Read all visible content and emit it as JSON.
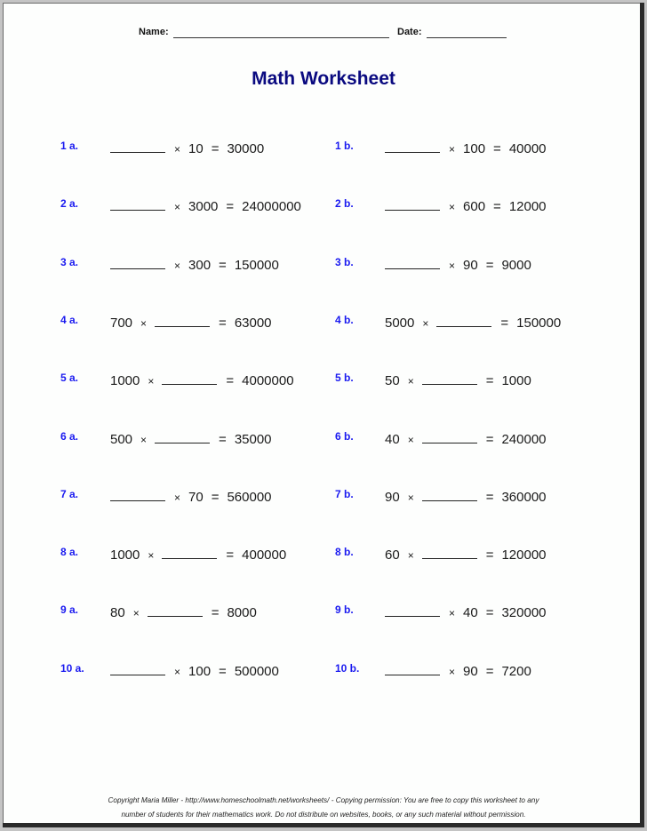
{
  "header": {
    "name_label": "Name:",
    "date_label": "Date:"
  },
  "title": "Math Worksheet",
  "colors": {
    "title": "#0a0a80",
    "problem_number": "#1a1af0"
  },
  "problems": [
    {
      "label": "1 a.",
      "tokens": [
        "_",
        "×",
        "10",
        "=",
        "30000"
      ]
    },
    {
      "label": "1 b.",
      "tokens": [
        "_",
        "×",
        "100",
        "=",
        "40000"
      ]
    },
    {
      "label": "2 a.",
      "tokens": [
        "_",
        "×",
        "3000",
        "=",
        "24000000"
      ]
    },
    {
      "label": "2 b.",
      "tokens": [
        "_",
        "×",
        "600",
        "=",
        "12000"
      ]
    },
    {
      "label": "3 a.",
      "tokens": [
        "_",
        "×",
        "300",
        "=",
        "150000"
      ]
    },
    {
      "label": "3 b.",
      "tokens": [
        "_",
        "×",
        "90",
        "=",
        "9000"
      ]
    },
    {
      "label": "4 a.",
      "tokens": [
        "700",
        "×",
        "_",
        "=",
        "63000"
      ]
    },
    {
      "label": "4 b.",
      "tokens": [
        "5000",
        "×",
        "_",
        "=",
        "150000"
      ]
    },
    {
      "label": "5 a.",
      "tokens": [
        "1000",
        "×",
        "_",
        "=",
        "4000000"
      ]
    },
    {
      "label": "5 b.",
      "tokens": [
        "50",
        "×",
        "_",
        "=",
        "1000"
      ]
    },
    {
      "label": "6 a.",
      "tokens": [
        "500",
        "×",
        "_",
        "=",
        "35000"
      ]
    },
    {
      "label": "6 b.",
      "tokens": [
        "40",
        "×",
        "_",
        "=",
        "240000"
      ]
    },
    {
      "label": "7 a.",
      "tokens": [
        "_",
        "×",
        "70",
        "=",
        "560000"
      ]
    },
    {
      "label": "7 b.",
      "tokens": [
        "90",
        "×",
        "_",
        "=",
        "360000"
      ]
    },
    {
      "label": "8 a.",
      "tokens": [
        "1000",
        "×",
        "_",
        "=",
        "400000"
      ]
    },
    {
      "label": "8 b.",
      "tokens": [
        "60",
        "×",
        "_",
        "=",
        "120000"
      ]
    },
    {
      "label": "9 a.",
      "tokens": [
        "80",
        "×",
        "_",
        "=",
        "8000"
      ]
    },
    {
      "label": "9 b.",
      "tokens": [
        "_",
        "×",
        "40",
        "=",
        "320000"
      ]
    },
    {
      "label": "10 a.",
      "tokens": [
        "_",
        "×",
        "100",
        "=",
        "500000"
      ]
    },
    {
      "label": "10 b.",
      "tokens": [
        "_",
        "×",
        "90",
        "=",
        "7200"
      ]
    }
  ],
  "footer": {
    "line1": "Copyright Maria Miller - http://www.homeschoolmath.net/worksheets/ - Copying permission: You are free to copy this worksheet to any",
    "line2": "number of students for their mathematics work. Do not distribute on websites, books, or any such material without permission."
  }
}
